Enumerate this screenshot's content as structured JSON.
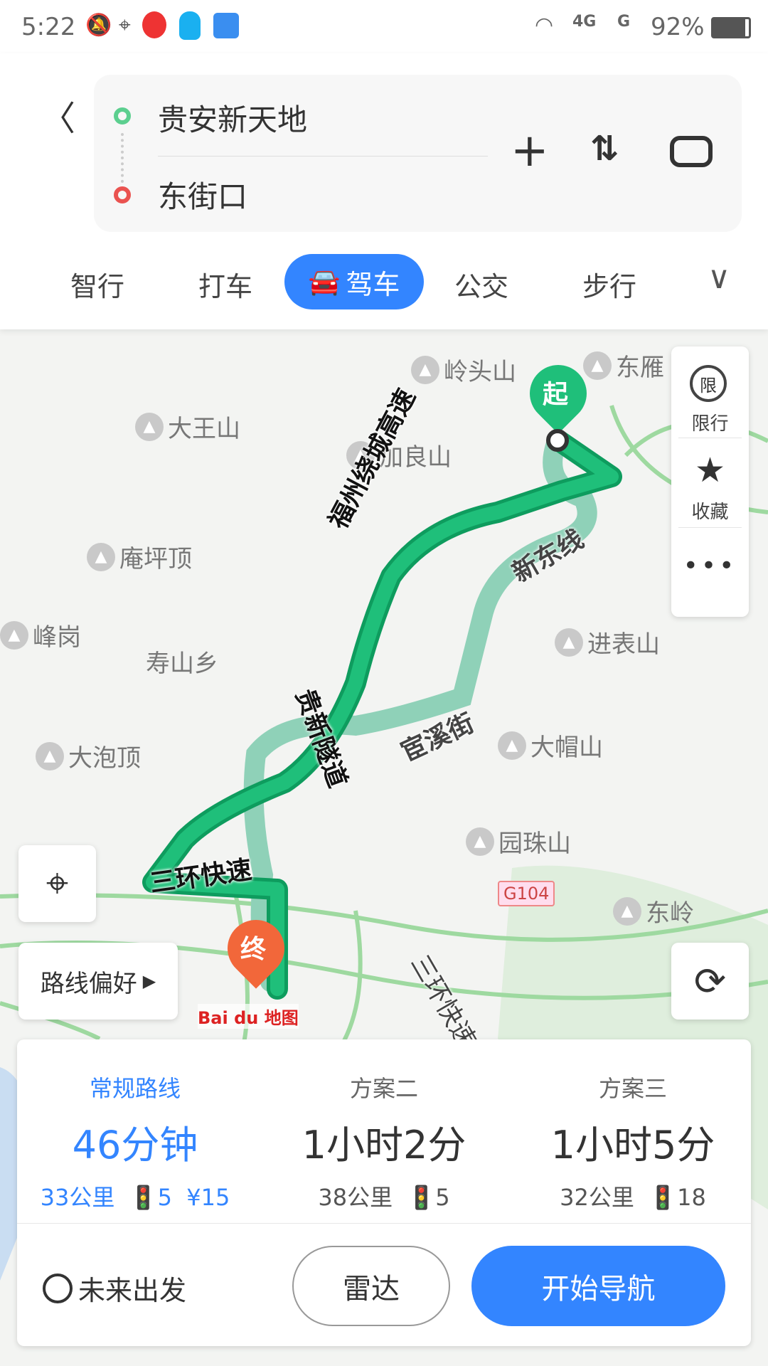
{
  "status": {
    "time": "5:22",
    "battery": "92%",
    "network": [
      "4G",
      "G"
    ]
  },
  "route": {
    "start": "贵安新天地",
    "end": "东街口"
  },
  "tabs": [
    {
      "label": "智行"
    },
    {
      "label": "打车"
    },
    {
      "label": "驾车",
      "active": true
    },
    {
      "label": "公交"
    },
    {
      "label": "步行"
    }
  ],
  "map": {
    "places": [
      "岭头山",
      "东雁",
      "大王山",
      "加良山",
      "庵坪顶",
      "峰岗",
      "寿山乡",
      "进表山",
      "大帽山",
      "大泡顶",
      "园珠山",
      "东岭"
    ],
    "road_labels": [
      "福州绕城高速",
      "贵新隧道",
      "宦溪街",
      "新东线",
      "三环快速",
      "三环快速"
    ],
    "shield": "G104",
    "start_marker": "起",
    "end_marker": "终",
    "logo": "Bai du 地图",
    "side": {
      "restrict": "限行",
      "restrict_icon": "限",
      "favorite": "收藏"
    },
    "preference": "路线偏好",
    "colors": {
      "route": "#1fbf7a",
      "alt_route": "#8fd1b8",
      "accent": "#3385ff"
    }
  },
  "plans": [
    {
      "label": "常规路线",
      "time": "46分钟",
      "distance": "33公里",
      "lights": "5",
      "toll": "¥15"
    },
    {
      "label": "方案二",
      "time": "1小时2分",
      "distance": "38公里",
      "lights": "5"
    },
    {
      "label": "方案三",
      "time": "1小时5分",
      "distance": "32公里",
      "lights": "18"
    }
  ],
  "actions": {
    "future": "未来出发",
    "radar": "雷达",
    "navigate": "开始导航"
  }
}
